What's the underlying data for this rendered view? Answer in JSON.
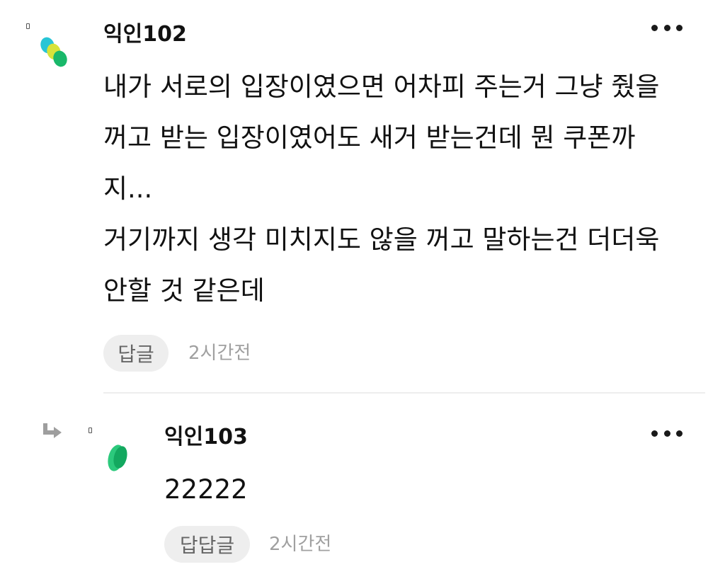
{
  "comments": [
    {
      "username": "익인102",
      "body": "내가 서로의 입장이였으면 어차피 주는거 그냥 줬을\n꺼고 받는 입장이였어도 새거 받는건데 뭔 쿠폰까\n지...\n거기까지 생각 미치지도 않을 꺼고 말하는건 더더욱\n안할 것 같은데",
      "reply_label": "답글",
      "time": "2시간전",
      "avatar_colors": [
        "#27c5d6",
        "#d7e33a",
        "#19b86a"
      ]
    },
    {
      "username": "익인103",
      "body": "22222",
      "reply_label": "답답글",
      "time": "2시간전",
      "avatar_colors": [
        "#2cc97c",
        "#13a85f"
      ]
    }
  ],
  "icons": {
    "more": "more-horizontal-icon",
    "reply_indicator": "reply-arrow-icon"
  },
  "colors": {
    "reply_button_bg": "#eeeeee",
    "reply_button_text": "#666666",
    "timestamp_text": "#a0a0a0",
    "divider": "#ededed",
    "reply_arrow": "#9e9e9e"
  }
}
